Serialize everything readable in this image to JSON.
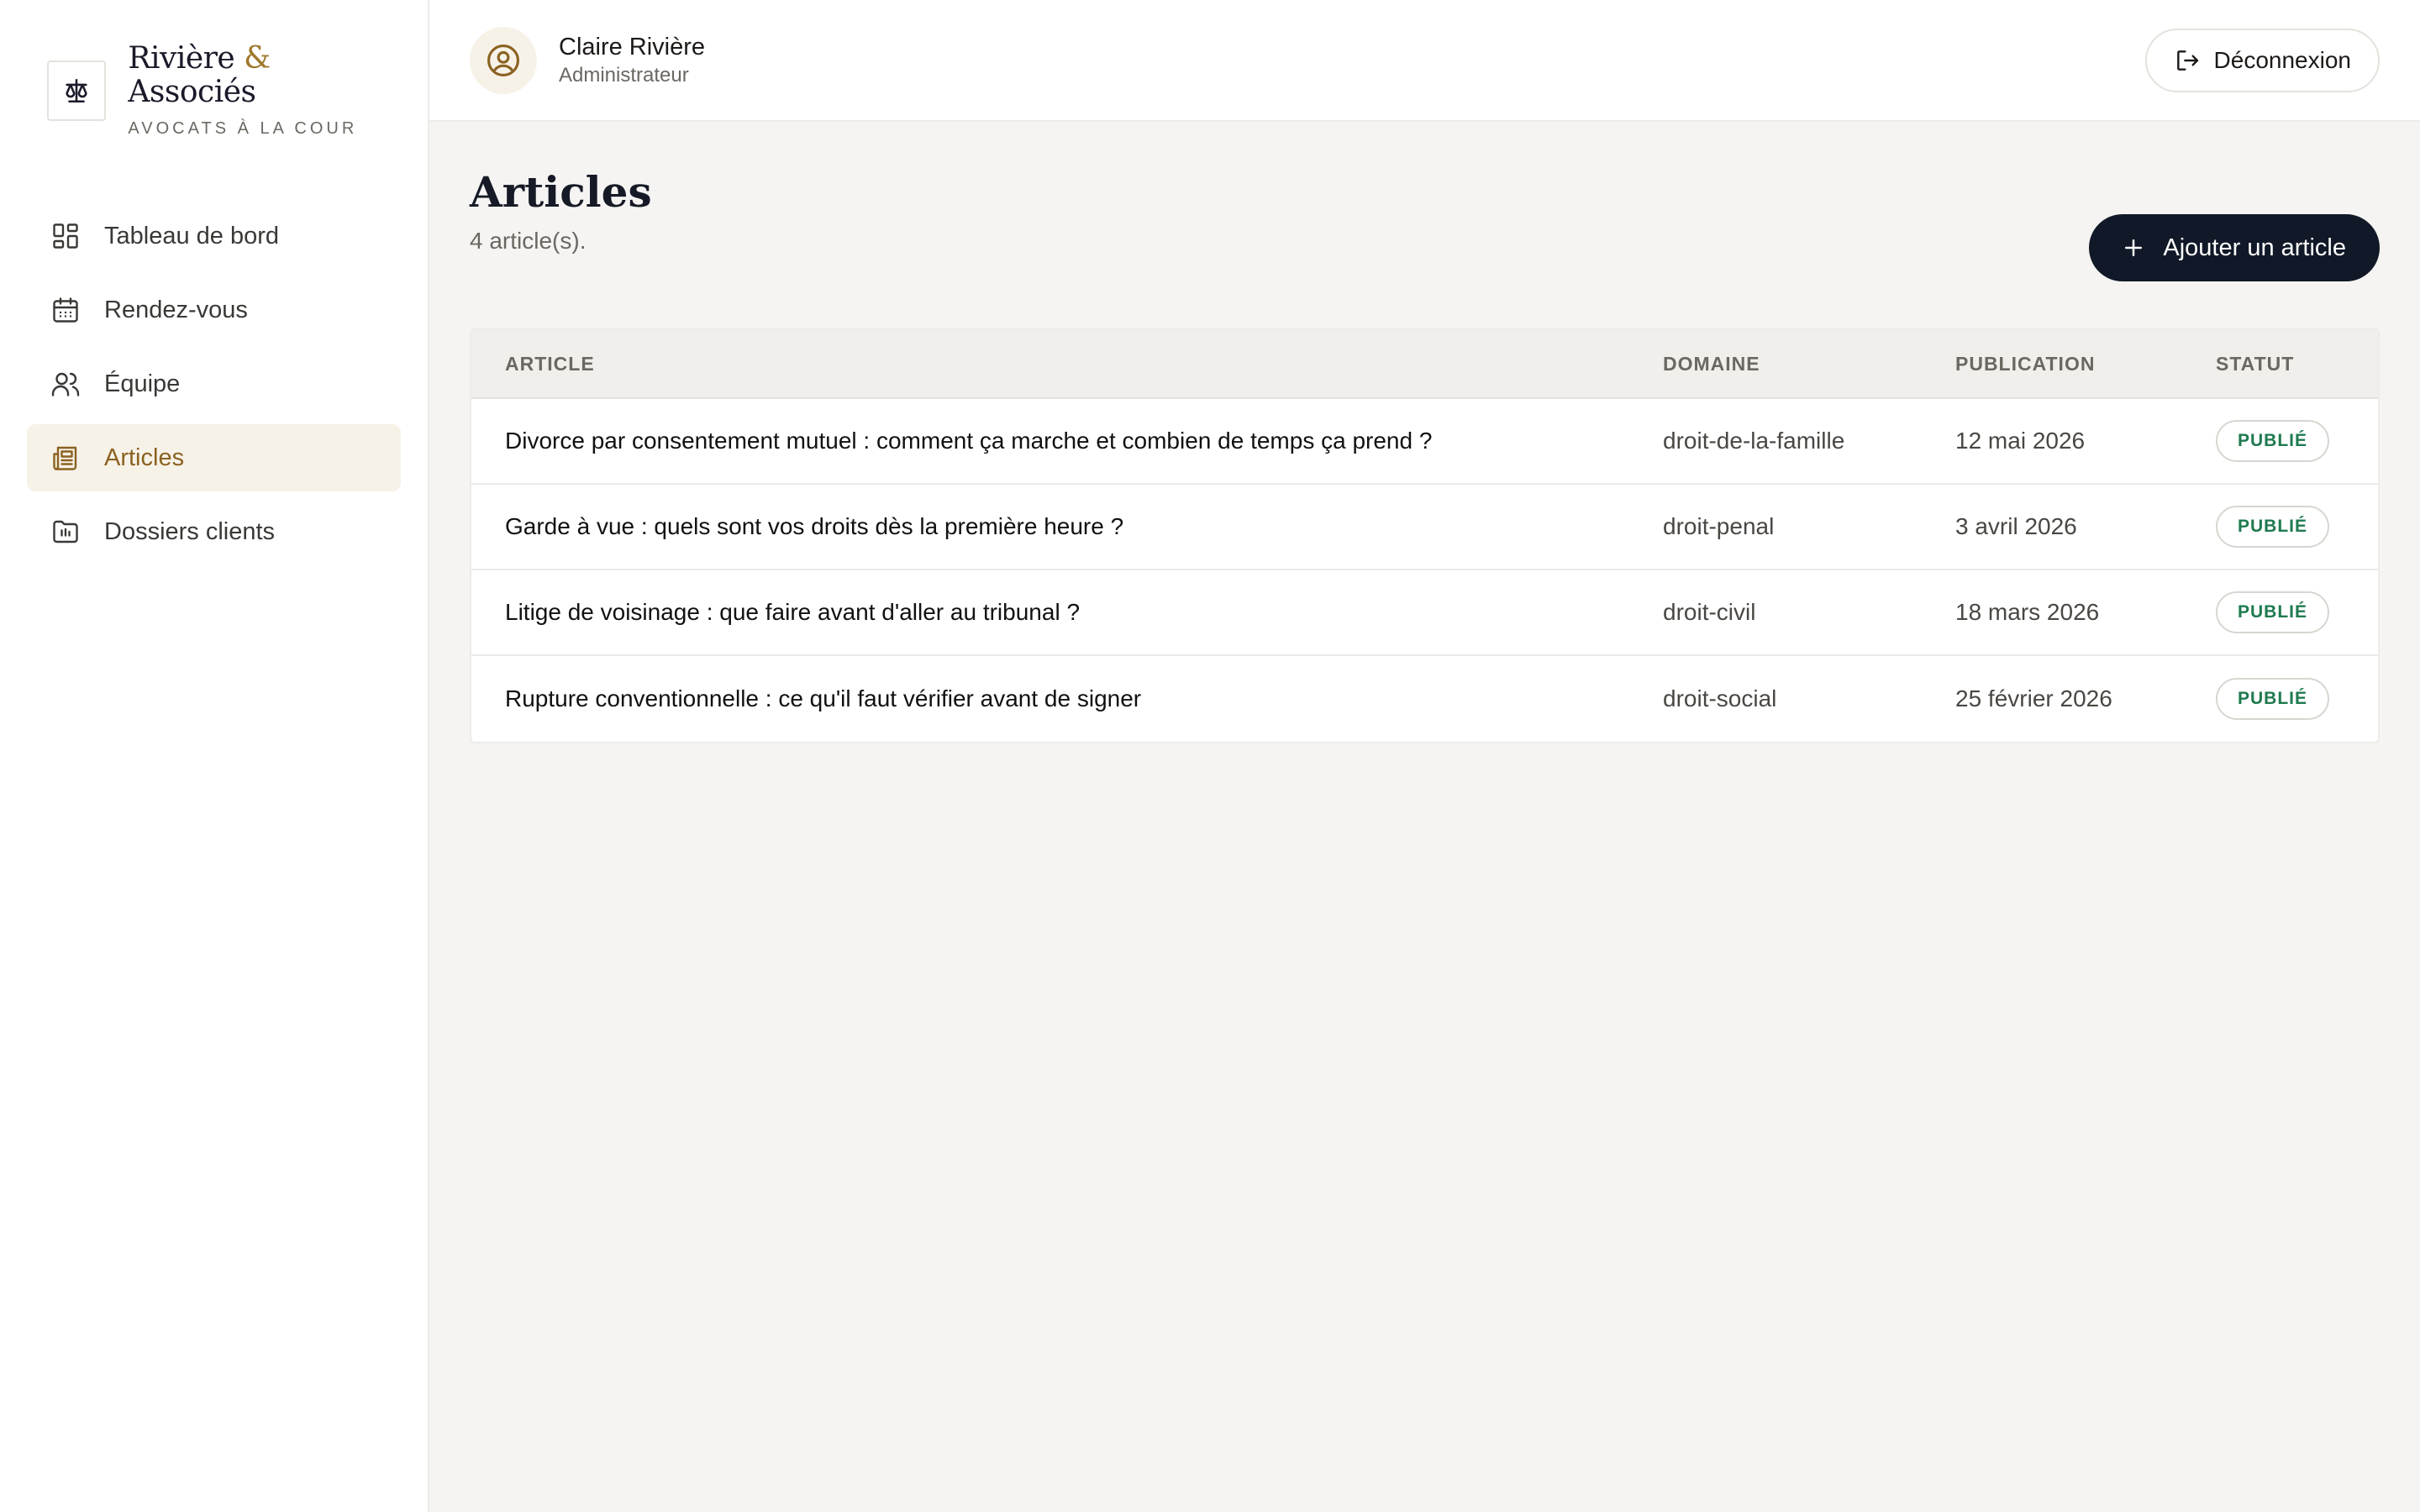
{
  "brand": {
    "name_part1": "Rivière",
    "name_amp": "&",
    "name_part2": "Associés",
    "subtitle": "AVOCATS À LA COUR",
    "logo_icon": "scales-icon"
  },
  "sidebar": {
    "items": [
      {
        "label": "Tableau de bord",
        "icon": "dashboard-icon",
        "active": false
      },
      {
        "label": "Rendez-vous",
        "icon": "calendar-icon",
        "active": false
      },
      {
        "label": "Équipe",
        "icon": "users-icon",
        "active": false
      },
      {
        "label": "Articles",
        "icon": "newspaper-icon",
        "active": true
      },
      {
        "label": "Dossiers clients",
        "icon": "folder-icon",
        "active": false
      }
    ]
  },
  "user": {
    "name": "Claire Rivière",
    "role": "Administrateur"
  },
  "header": {
    "logout_label": "Déconnexion"
  },
  "page": {
    "title": "Articles",
    "count": "4 article(s).",
    "add_label": "Ajouter un article"
  },
  "table": {
    "headers": [
      "ARTICLE",
      "DOMAINE",
      "PUBLICATION",
      "STATUT"
    ],
    "rows": [
      {
        "title": "Divorce par consentement mutuel : comment ça marche et combien de temps ça prend ?",
        "domain": "droit-de-la-famille",
        "date": "12 mai 2026",
        "status": "PUBLIÉ"
      },
      {
        "title": "Garde à vue : quels sont vos droits dès la première heure ?",
        "domain": "droit-penal",
        "date": "3 avril 2026",
        "status": "PUBLIÉ"
      },
      {
        "title": "Litige de voisinage : que faire avant d'aller au tribunal ?",
        "domain": "droit-civil",
        "date": "18 mars 2026",
        "status": "PUBLIÉ"
      },
      {
        "title": "Rupture conventionnelle : ce qu'il faut vérifier avant de signer",
        "domain": "droit-social",
        "date": "25 février 2026",
        "status": "PUBLIÉ"
      }
    ]
  },
  "colors": {
    "accent": "#a0782c",
    "active_bg": "#f7f2e8",
    "primary_button": "#111827",
    "status_published": "#1f7a4f",
    "background": "#f5f4f2"
  }
}
